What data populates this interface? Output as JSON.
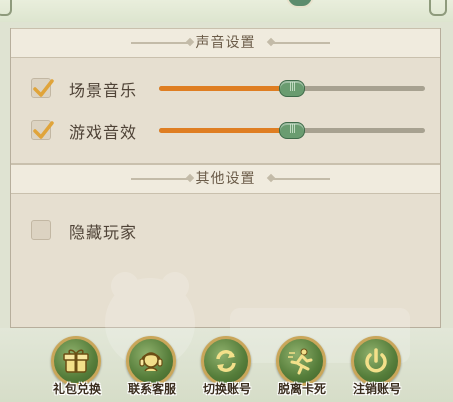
{
  "sections": {
    "sound": {
      "title": "声音设置",
      "rows": [
        {
          "label": "场景音乐",
          "checked": true,
          "volume": 0.5
        },
        {
          "label": "游戏音效",
          "checked": true,
          "volume": 0.5
        }
      ]
    },
    "other": {
      "title": "其他设置",
      "rows": [
        {
          "label": "隐藏玩家",
          "checked": false
        }
      ]
    }
  },
  "buttons": [
    {
      "label": "礼包兑换",
      "icon": "gift-icon"
    },
    {
      "label": "联系客服",
      "icon": "customer-service-icon"
    },
    {
      "label": "切换账号",
      "icon": "switch-account-icon"
    },
    {
      "label": "脱离卡死",
      "icon": "escape-stuck-icon"
    },
    {
      "label": "注销账号",
      "icon": "power-icon"
    }
  ],
  "colors": {
    "slider_fill": "#df7e22",
    "slider_thumb": "#6a9c70",
    "button_green": "#557d3a",
    "button_ring": "#c9a65a"
  }
}
